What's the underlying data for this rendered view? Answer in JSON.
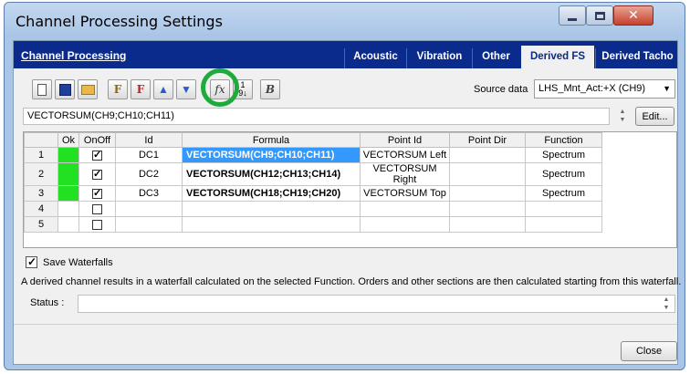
{
  "window": {
    "title": "Channel Processing Settings"
  },
  "tabbar": {
    "section_title": "Channel Processing",
    "tabs": [
      {
        "label": "Acoustic",
        "active": false
      },
      {
        "label": "Vibration",
        "active": false
      },
      {
        "label": "Other",
        "active": false
      },
      {
        "label": "Derived FS",
        "active": true
      },
      {
        "label": "Derived Tacho",
        "active": false
      }
    ]
  },
  "toolbar": {
    "source_label": "Source data",
    "source_value": "LHS_Mnt_Act:+X (CH9)"
  },
  "formula": {
    "value": "VECTORSUM(CH9;CH10;CH11)",
    "edit_label": "Edit..."
  },
  "grid": {
    "columns": [
      "",
      "Ok",
      "OnOff",
      "Id",
      "Formula",
      "Point Id",
      "Point Dir",
      "Function"
    ],
    "rows": [
      {
        "num": "1",
        "ok": true,
        "on": true,
        "id": "DC1",
        "formula": "VECTORSUM(CH9;CH10;CH11)",
        "point_id": "VECTORSUM Left",
        "point_dir": "",
        "function": "Spectrum"
      },
      {
        "num": "2",
        "ok": true,
        "on": true,
        "id": "DC2",
        "formula": "VECTORSUM(CH12;CH13;CH14)",
        "point_id": "VECTORSUM Right",
        "point_dir": "",
        "function": "Spectrum"
      },
      {
        "num": "3",
        "ok": true,
        "on": true,
        "id": "DC3",
        "formula": "VECTORSUM(CH18;CH19;CH20)",
        "point_id": "VECTORSUM Top",
        "point_dir": "",
        "function": "Spectrum"
      },
      {
        "num": "4",
        "ok": false,
        "on": false,
        "id": "",
        "formula": "",
        "point_id": "",
        "point_dir": "",
        "function": ""
      },
      {
        "num": "5",
        "ok": false,
        "on": false,
        "id": "",
        "formula": "",
        "point_id": "",
        "point_dir": "",
        "function": ""
      }
    ]
  },
  "options": {
    "save_waterfalls_label": "Save Waterfalls",
    "info_text": "A derived channel results in a waterfall calculated on the selected Function. Orders and other sections are then calculated starting from this waterfall."
  },
  "status": {
    "label": "Status :",
    "value": ""
  },
  "footer": {
    "close_label": "Close"
  },
  "colors": {
    "tabstrip": "#0a2a8c",
    "ok_green": "#22e022",
    "selection": "#3399ff",
    "highlight_ring": "#1eab3c"
  }
}
